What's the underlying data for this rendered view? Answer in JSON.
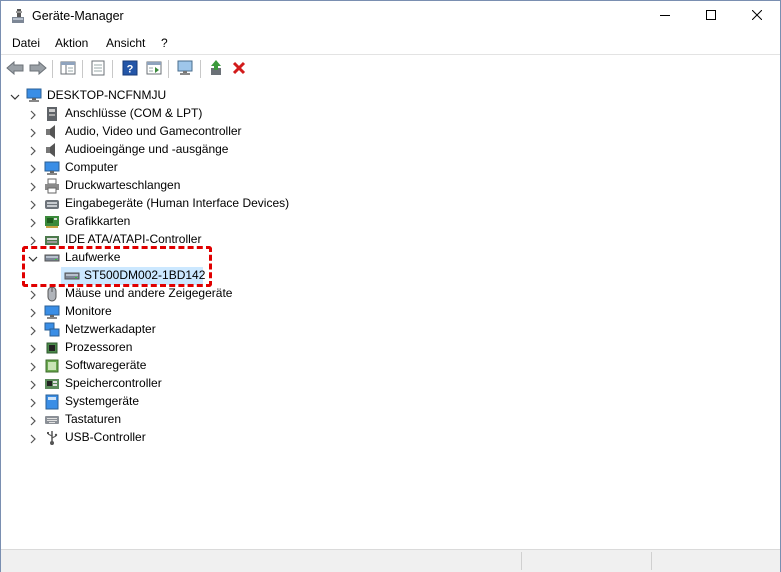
{
  "window": {
    "title": "Geräte-Manager"
  },
  "menu": [
    "Datei",
    "Aktion",
    "Ansicht",
    "?"
  ],
  "toolbar": [
    {
      "icon": "back-arrow-icon"
    },
    {
      "icon": "forward-arrow-icon"
    },
    {
      "icon": "show-hide-console-tree-icon"
    },
    {
      "icon": "properties-icon"
    },
    {
      "icon": "help-icon"
    },
    {
      "icon": "action-pane-icon"
    },
    {
      "icon": "scan-hardware-changes-icon"
    },
    {
      "icon": "update-driver-icon"
    },
    {
      "icon": "uninstall-device-icon"
    }
  ],
  "tree": {
    "root": "DESKTOP-NCFNMJU",
    "categories": [
      {
        "label": "Anschlüsse (COM & LPT)",
        "icon": "port-icon"
      },
      {
        "label": "Audio, Video und Gamecontroller",
        "icon": "speaker-icon"
      },
      {
        "label": "Audioeingänge und -ausgänge",
        "icon": "speaker-icon"
      },
      {
        "label": "Computer",
        "icon": "monitor-icon"
      },
      {
        "label": "Druckwarteschlangen",
        "icon": "printer-icon"
      },
      {
        "label": "Eingabegeräte (Human Interface Devices)",
        "icon": "hid-icon"
      },
      {
        "label": "Grafikkarten",
        "icon": "display-adapter-icon"
      },
      {
        "label": "IDE ATA/ATAPI-Controller",
        "icon": "ide-controller-icon"
      },
      {
        "label": "Laufwerke",
        "icon": "disk-drive-icon",
        "expanded": true,
        "children": [
          "ST500DM002-1BD142"
        ]
      },
      {
        "label": "Mäuse und andere Zeigegeräte",
        "icon": "mouse-icon"
      },
      {
        "label": "Monitore",
        "icon": "monitor-icon"
      },
      {
        "label": "Netzwerkadapter",
        "icon": "network-adapter-icon"
      },
      {
        "label": "Prozessoren",
        "icon": "processor-icon"
      },
      {
        "label": "Softwaregeräte",
        "icon": "software-device-icon"
      },
      {
        "label": "Speichercontroller",
        "icon": "storage-controller-icon"
      },
      {
        "label": "Systemgeräte",
        "icon": "system-device-icon"
      },
      {
        "label": "Tastaturen",
        "icon": "keyboard-icon"
      },
      {
        "label": "USB-Controller",
        "icon": "usb-icon"
      }
    ]
  },
  "colors": {
    "highlight": "#e00000",
    "selection": "#cce8ff",
    "close_icon": "#d21b1b"
  }
}
